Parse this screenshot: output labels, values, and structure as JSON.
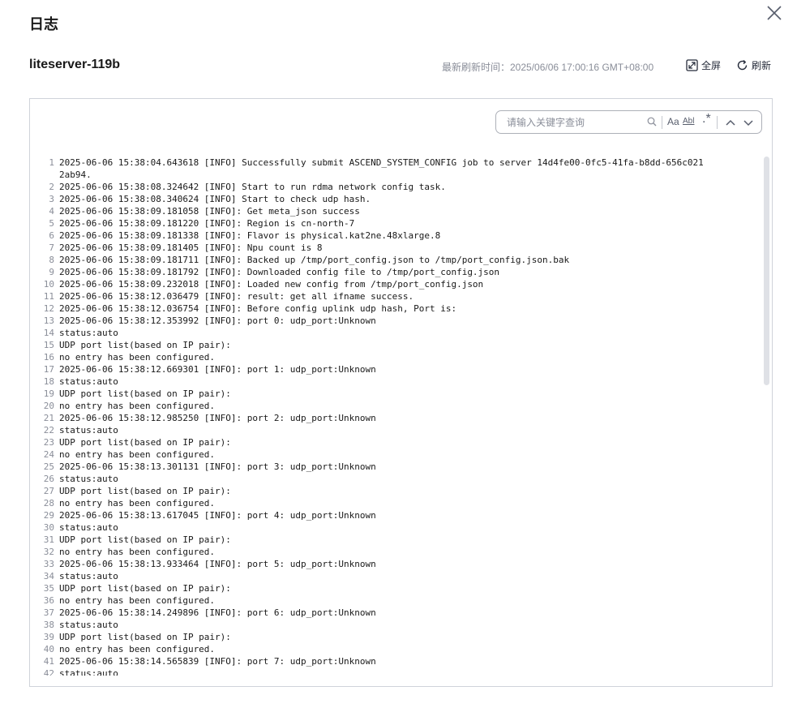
{
  "dialog": {
    "title": "日志"
  },
  "header": {
    "server_name": "liteserver-119b",
    "refresh_time": "最新刷新时间：2025/06/06 17:00:16 GMT+08:00",
    "fullscreen_label": "全屏",
    "refresh_label": "刷新"
  },
  "search": {
    "placeholder": "请输入关键字查询",
    "match_case_label": "Aa",
    "whole_word_label": "Abl",
    "regex_label": ".*"
  },
  "icons": {
    "close": "close-icon",
    "fullscreen": "expand-icon",
    "refresh": "refresh-icon",
    "search": "search-icon",
    "prev": "chevron-up-icon",
    "next": "chevron-down-icon"
  },
  "log": {
    "lines": [
      {
        "n": "1",
        "t": "2025-06-06 15:38:04.643618 [INFO] Successfully submit ASCEND_SYSTEM_CONFIG job to server 14d4fe00-0fc5-41fa-b8dd-656c0212ab94."
      },
      {
        "n": "2",
        "t": "2025-06-06 15:38:08.324642 [INFO] Start to run rdma network config task."
      },
      {
        "n": "3",
        "t": "2025-06-06 15:38:08.340624 [INFO] Start to check udp hash."
      },
      {
        "n": "4",
        "t": "2025-06-06 15:38:09.181058 [INFO]: Get meta_json success"
      },
      {
        "n": "5",
        "t": "2025-06-06 15:38:09.181220 [INFO]: Region is cn-north-7"
      },
      {
        "n": "6",
        "t": "2025-06-06 15:38:09.181338 [INFO]: Flavor is physical.kat2ne.48xlarge.8"
      },
      {
        "n": "7",
        "t": "2025-06-06 15:38:09.181405 [INFO]: Npu count is 8"
      },
      {
        "n": "8",
        "t": "2025-06-06 15:38:09.181711 [INFO]: Backed up /tmp/port_config.json to /tmp/port_config.json.bak"
      },
      {
        "n": "9",
        "t": "2025-06-06 15:38:09.181792 [INFO]: Downloaded config file to /tmp/port_config.json"
      },
      {
        "n": "10",
        "t": "2025-06-06 15:38:09.232018 [INFO]: Loaded new config from /tmp/port_config.json"
      },
      {
        "n": "11",
        "t": "2025-06-06 15:38:12.036479 [INFO]: result: get all ifname success."
      },
      {
        "n": "12",
        "t": "2025-06-06 15:38:12.036754 [INFO]: Before config uplink udp hash, Port is:"
      },
      {
        "n": "13",
        "t": "2025-06-06 15:38:12.353992 [INFO]: port 0: udp_port:Unknown"
      },
      {
        "n": "14",
        "t": "status:auto"
      },
      {
        "n": "15",
        "t": "UDP port list(based on IP pair):"
      },
      {
        "n": "16",
        "t": "no entry has been configured."
      },
      {
        "n": "17",
        "t": "2025-06-06 15:38:12.669301 [INFO]: port 1: udp_port:Unknown"
      },
      {
        "n": "18",
        "t": "status:auto"
      },
      {
        "n": "19",
        "t": "UDP port list(based on IP pair):"
      },
      {
        "n": "20",
        "t": "no entry has been configured."
      },
      {
        "n": "21",
        "t": "2025-06-06 15:38:12.985250 [INFO]: port 2: udp_port:Unknown"
      },
      {
        "n": "22",
        "t": "status:auto"
      },
      {
        "n": "23",
        "t": "UDP port list(based on IP pair):"
      },
      {
        "n": "24",
        "t": "no entry has been configured."
      },
      {
        "n": "25",
        "t": "2025-06-06 15:38:13.301131 [INFO]: port 3: udp_port:Unknown"
      },
      {
        "n": "26",
        "t": "status:auto"
      },
      {
        "n": "27",
        "t": "UDP port list(based on IP pair):"
      },
      {
        "n": "28",
        "t": "no entry has been configured."
      },
      {
        "n": "29",
        "t": "2025-06-06 15:38:13.617045 [INFO]: port 4: udp_port:Unknown"
      },
      {
        "n": "30",
        "t": "status:auto"
      },
      {
        "n": "31",
        "t": "UDP port list(based on IP pair):"
      },
      {
        "n": "32",
        "t": "no entry has been configured."
      },
      {
        "n": "33",
        "t": "2025-06-06 15:38:13.933464 [INFO]: port 5: udp_port:Unknown"
      },
      {
        "n": "34",
        "t": "status:auto"
      },
      {
        "n": "35",
        "t": "UDP port list(based on IP pair):"
      },
      {
        "n": "36",
        "t": "no entry has been configured."
      },
      {
        "n": "37",
        "t": "2025-06-06 15:38:14.249896 [INFO]: port 6: udp_port:Unknown"
      },
      {
        "n": "38",
        "t": "status:auto"
      },
      {
        "n": "39",
        "t": "UDP port list(based on IP pair):"
      },
      {
        "n": "40",
        "t": "no entry has been configured."
      },
      {
        "n": "41",
        "t": "2025-06-06 15:38:14.565839 [INFO]: port 7: udp_port:Unknown"
      },
      {
        "n": "42",
        "t": "status:auto"
      }
    ]
  }
}
